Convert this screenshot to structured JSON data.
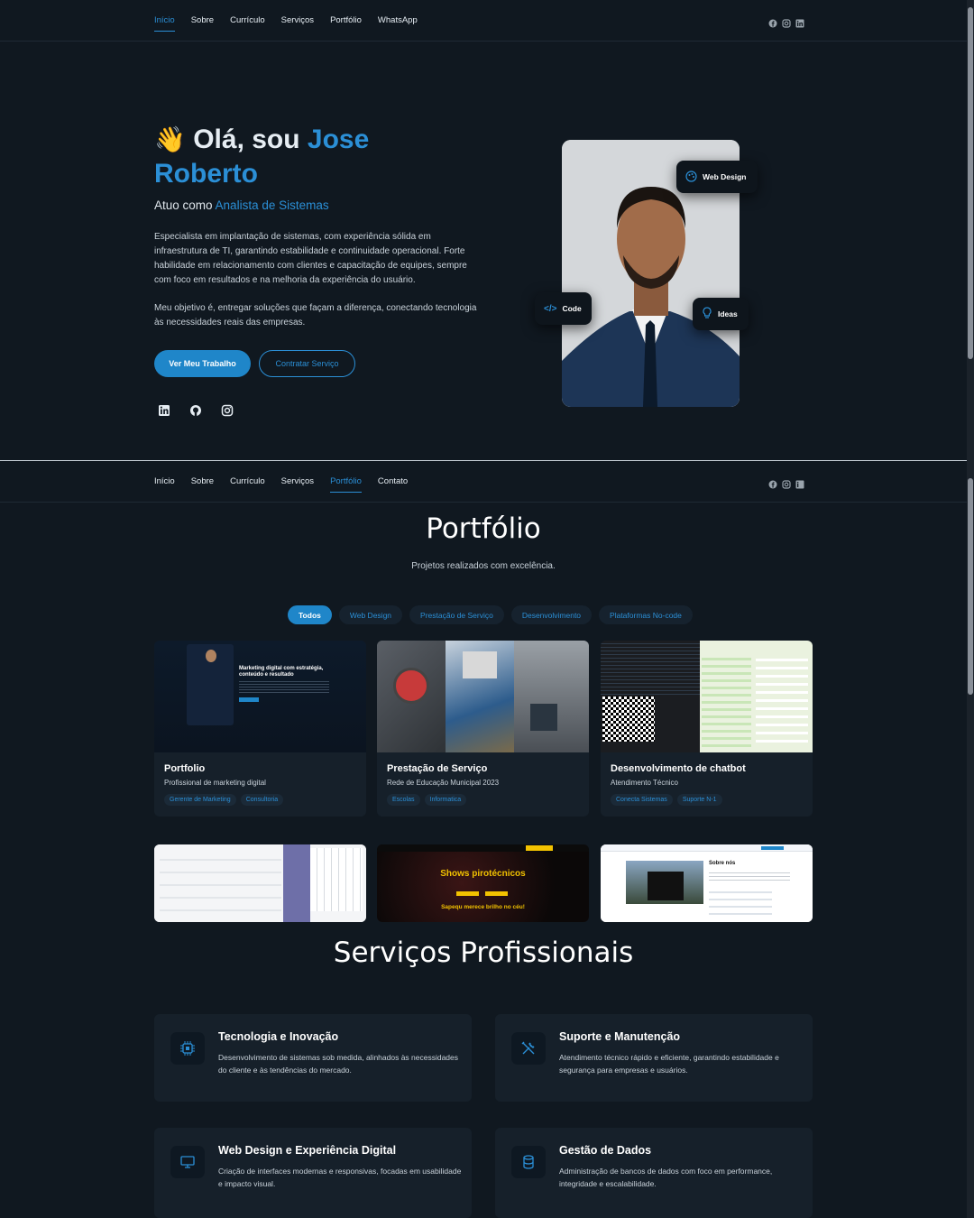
{
  "nav1": {
    "links": [
      "Início",
      "Sobre",
      "Currículo",
      "Serviços",
      "Portfólio",
      "WhatsApp"
    ],
    "active": 0
  },
  "nav2": {
    "links": [
      "Início",
      "Sobre",
      "Currículo",
      "Serviços",
      "Portfólio",
      "Contato"
    ],
    "active": 4
  },
  "hero": {
    "wave": "👋",
    "greeting": "Olá, sou ",
    "name_first": "Jose",
    "name_last": "Roberto",
    "role_prefix": "Atuo como ",
    "role": "Analista de Sistemas",
    "p1": "Especialista em implantação de sistemas, com experiência sólida em infraestrutura de TI, garantindo estabilidade e continuidade operacional. Forte habilidade em relacionamento com clientes e capacitação de equipes, sempre com foco em resultados e na melhoria da experiência do usuário.",
    "p2": "Meu objetivo é, entregar soluções que façam a diferença, conectando tecnologia às necessidades reais das empresas.",
    "btn_primary": "Ver Meu Trabalho",
    "btn_secondary": "Contratar Serviço",
    "badge_web": "Web Design",
    "badge_code": "Code",
    "badge_ideas": "Ideas"
  },
  "portfolio": {
    "title": "Portfólio",
    "subtitle": "Projetos realizados com excelência.",
    "filters": [
      "Todos",
      "Web Design",
      "Prestação de Serviço",
      "Desenvolvimento",
      "Plataformas No-code"
    ],
    "cards": [
      {
        "title": "Portfolio",
        "desc": "Profissional de marketing digital",
        "tags": [
          "Gerente de Marketing",
          "Consultoria"
        ]
      },
      {
        "title": "Prestação de Serviço",
        "desc": "Rede de Educação Municipal 2023",
        "tags": [
          "Escolas",
          "Informatica"
        ]
      },
      {
        "title": "Desenvolvimento de chatbot",
        "desc": "Atendimento Técnico",
        "tags": [
          "Conecta Sistemas",
          "Suporte N-1"
        ]
      }
    ],
    "thumb1_heading": "Marketing digital com estratégia, conteúdo e resultado",
    "thumb5_heading": "Shows pirotécnicos",
    "thumb5_sub": "Sapequ merece brilho no céu!",
    "thumb6_heading": "Sobre nós"
  },
  "services": {
    "title": "Serviços Profissionais",
    "items": [
      {
        "title": "Tecnologia e Inovação",
        "desc": "Desenvolvimento de sistemas sob medida, alinhados às necessidades do cliente e às tendências do mercado."
      },
      {
        "title": "Suporte e Manutenção",
        "desc": "Atendimento técnico rápido e eficiente, garantindo estabilidade e segurança para empresas e usuários."
      },
      {
        "title": "Web Design e Experiência Digital",
        "desc": "Criação de interfaces modernas e responsivas, focadas em usabilidade e impacto visual."
      },
      {
        "title": "Gestão de Dados",
        "desc": "Administração de bancos de dados com foco em performance, integridade e escalabilidade."
      }
    ]
  },
  "colors": {
    "accent": "#2b8fd6",
    "bg": "#101820",
    "card": "#16202a"
  }
}
